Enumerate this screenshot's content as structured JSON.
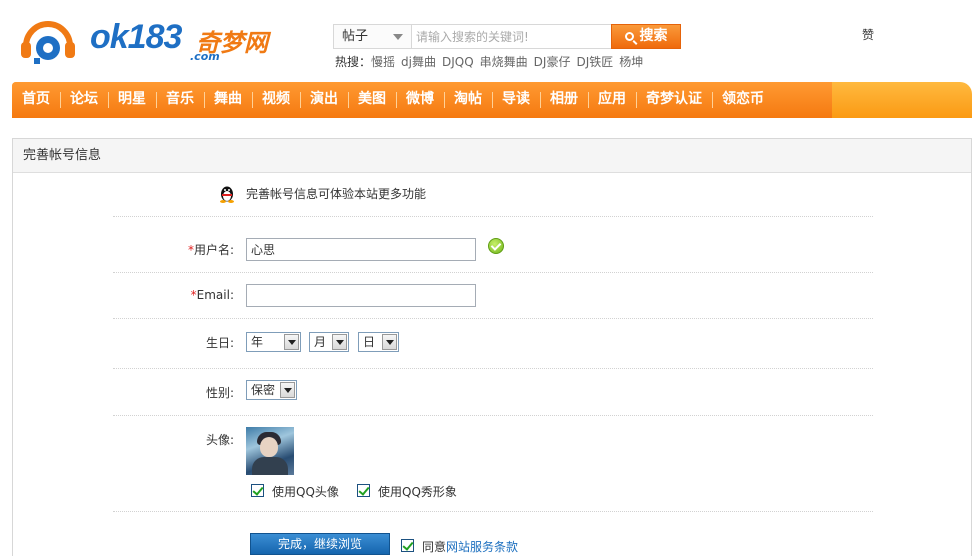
{
  "header": {
    "logo_text": "ok183",
    "logo_cn": "奇梦网",
    "logo_com": ".com",
    "praise": "赞"
  },
  "search": {
    "type_selected": "帖子",
    "placeholder": "请输入搜索的关键词!",
    "button_label": "搜索",
    "hot_label": "热搜：",
    "hot_terms": [
      "慢摇",
      "dj舞曲",
      "DJQQ",
      "串烧舞曲",
      "DJ豪仔",
      "DJ铁匠",
      "杨坤"
    ]
  },
  "nav": {
    "items": [
      "首页",
      "论坛",
      "明星",
      "音乐",
      "舞曲",
      "视频",
      "演出",
      "美图",
      "微博",
      "淘帖",
      "导读",
      "相册",
      "应用",
      "奇梦认证",
      "领恋币"
    ]
  },
  "panel": {
    "title": "完善帐号信息",
    "notice": "完善帐号信息可体验本站更多功能"
  },
  "form": {
    "required_mark": "*",
    "username_label": "用户名:",
    "username_value": "心思",
    "email_label": "Email:",
    "email_value": "",
    "birthday_label": "生日:",
    "birthday_year": "年",
    "birthday_month": "月",
    "birthday_day": "日",
    "gender_label": "性别:",
    "gender_value": "保密",
    "avatar_label": "头像:",
    "use_qq_avatar": "使用QQ头像",
    "use_qq_show": "使用QQ秀形象",
    "submit_label": "完成，继续浏览",
    "agree_prefix": "同意",
    "agree_link": "网站服务条款"
  },
  "colors": {
    "nav_orange": "#f57910",
    "link_blue": "#1c6fbf",
    "required_red": "#e02020"
  }
}
